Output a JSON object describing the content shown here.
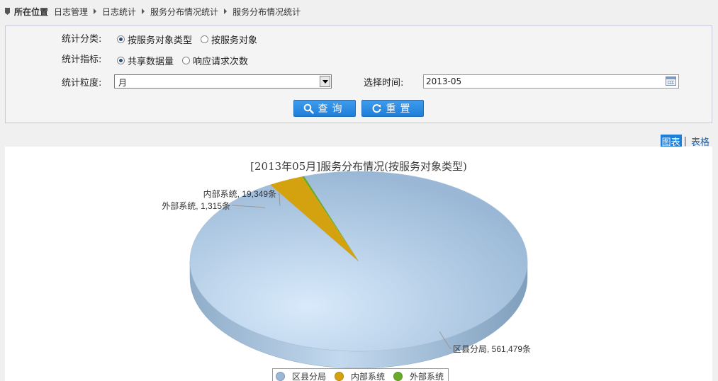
{
  "breadcrumb": {
    "label": "所在位置",
    "items": [
      "日志管理",
      "日志统计",
      "服务分布情况统计",
      "服务分布情况统计"
    ]
  },
  "filters": {
    "category": {
      "label": "统计分类:",
      "options": [
        "按服务对象类型",
        "按服务对象"
      ],
      "selected": 0
    },
    "metric": {
      "label": "统计指标:",
      "options": [
        "共享数据量",
        "响应请求次数"
      ],
      "selected": 0
    },
    "granularity": {
      "label": "统计粒度:",
      "value": "月"
    },
    "time": {
      "label": "选择时间:",
      "value": "2013-05"
    }
  },
  "buttons": {
    "query": "查询",
    "reset": "重置"
  },
  "view_toggle": {
    "chart": "图表",
    "separator": "|",
    "table": "表格"
  },
  "chart_data": {
    "type": "pie",
    "title": "[2013年05月]服务分布情况(按服务对象类型)",
    "unit": "条",
    "slices": [
      {
        "name": "区县分局",
        "value": 561479,
        "label": "区县分局, 561,479条",
        "color": "#9ab8d6"
      },
      {
        "name": "内部系统",
        "value": 19349,
        "label": "内部系统, 19,349条",
        "color": "#d4a20e"
      },
      {
        "name": "外部系统",
        "value": 1315,
        "label": "外部系统, 1,315条",
        "color": "#6aaa2a"
      }
    ],
    "legend": [
      "区县分局",
      "内部系统",
      "外部系统"
    ],
    "legend_position": "bottom"
  }
}
